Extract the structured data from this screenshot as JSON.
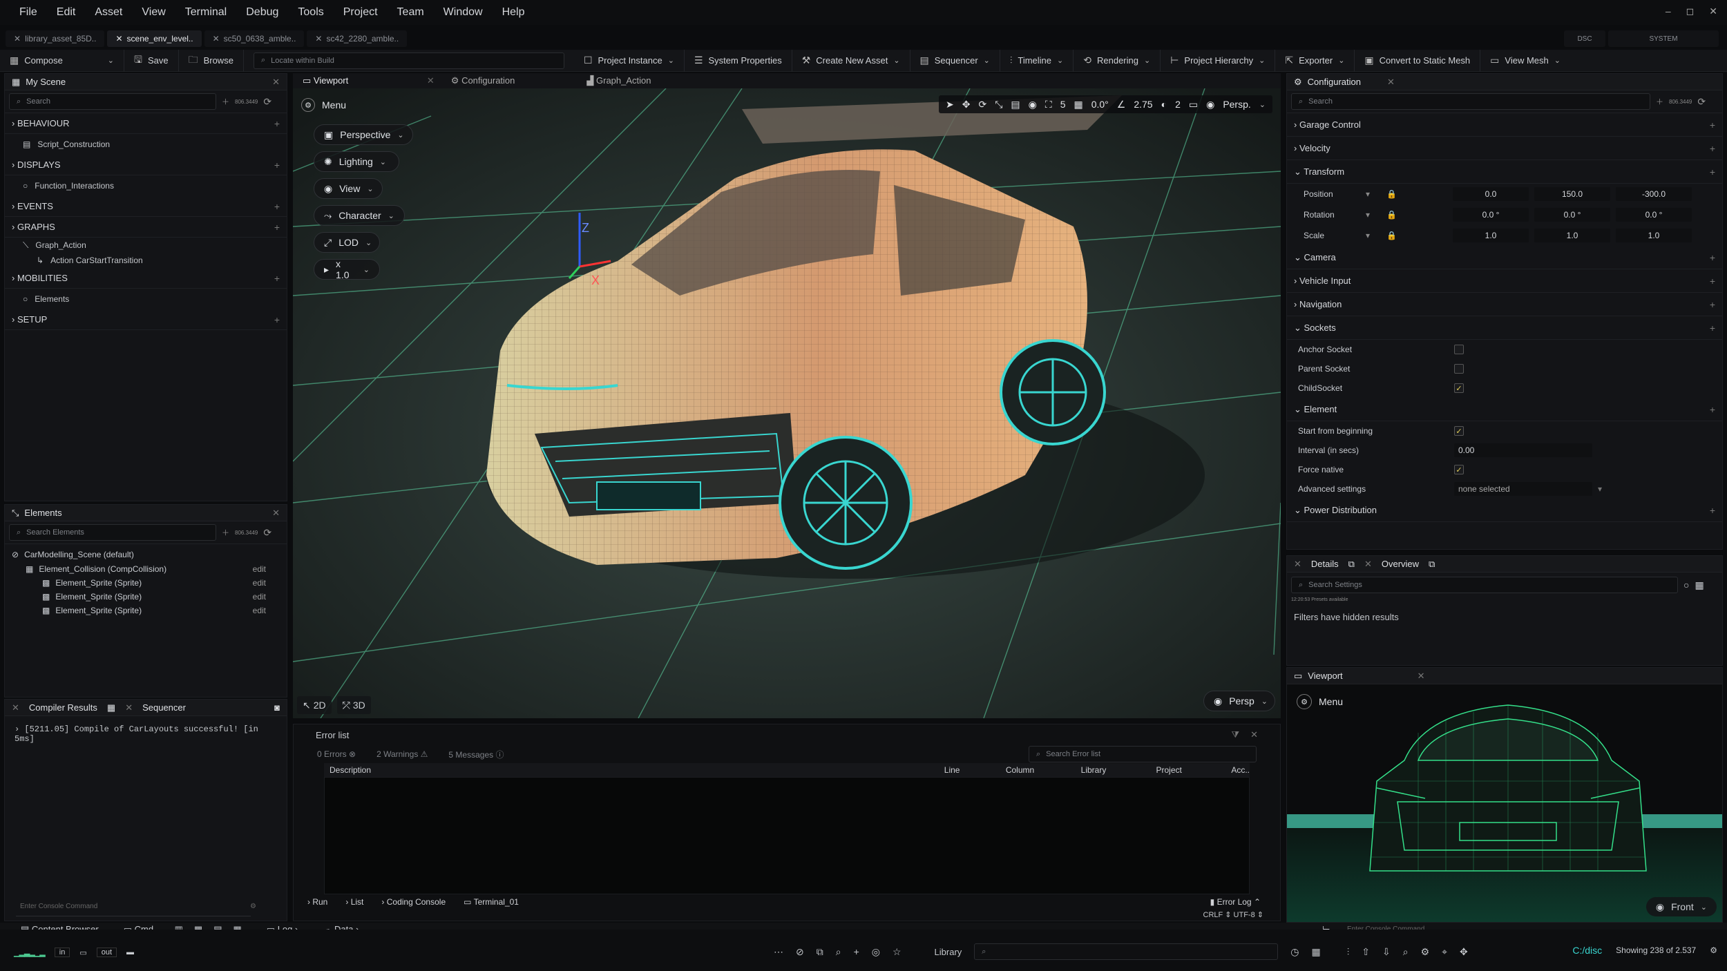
{
  "menu": [
    "File",
    "Edit",
    "Asset",
    "View",
    "Terminal",
    "Debug",
    "Tools",
    "Project",
    "Team",
    "Window",
    "Help"
  ],
  "window_controls": [
    "–",
    "◻",
    "✕"
  ],
  "doc_tabs": [
    {
      "label": "library_asset_85D.."
    },
    {
      "label": "scene_env_level.."
    },
    {
      "label": "sc50_0638_amble.."
    },
    {
      "label": "sc42_2280_amble.."
    }
  ],
  "top_right_tabs": [
    "DSC",
    "SYSTEM"
  ],
  "toolbar": {
    "compose": "Compose",
    "save": "Save",
    "browse": "Browse",
    "locate_placeholder": "Locate within Build",
    "project_instance": "Project Instance",
    "system_properties": "System Properties",
    "create_new_asset": "Create New Asset",
    "sequencer": "Sequencer",
    "timeline": "Timeline",
    "rendering": "Rendering",
    "project_hierarchy": "Project Hierarchy",
    "exporter": "Exporter",
    "convert": "Convert to Static Mesh",
    "view_mesh": "View Mesh"
  },
  "scene_panel": {
    "title": "My Scene",
    "search": "Search",
    "count": "806.3449",
    "sections": [
      {
        "name": "BEHAVIOUR",
        "items": [
          "Script_Construction"
        ]
      },
      {
        "name": "DISPLAYS",
        "items": [
          "Function_Interactions"
        ]
      },
      {
        "name": "EVENTS",
        "items": []
      },
      {
        "name": "GRAPHS",
        "items": [
          "Graph_Action",
          "Action CarStartTransition"
        ]
      },
      {
        "name": "MOBILITIES",
        "items": [
          "Elements"
        ]
      },
      {
        "name": "SETUP",
        "items": []
      }
    ]
  },
  "elements_panel": {
    "title": "Elements",
    "search": "Search Elements",
    "count": "806.3449",
    "root": "CarModelling_Scene (default)",
    "collision": "Element_Collision (CompCollision)",
    "sprites": [
      "Element_Sprite (Sprite)",
      "Element_Sprite (Sprite)",
      "Element_Sprite (Sprite)"
    ],
    "edit": "edit"
  },
  "compiler": {
    "tab1": "Compiler Results",
    "tab2": "Sequencer",
    "line": "[5211.05] Compile of CarLayouts successful! [in 5ms]",
    "console_placeholder": "Enter Console Command"
  },
  "viewport": {
    "tabs": [
      "Viewport",
      "Configuration",
      "Graph_Action"
    ],
    "menu": "Menu",
    "buttons": [
      "Perspective",
      "Lighting",
      "View",
      "Character",
      "LOD",
      "x 1.0"
    ],
    "top_values": {
      "grid": "5",
      "angle": "0.0°",
      "scale": "2.75",
      "cams": "2",
      "persp": "Persp."
    },
    "mode2d": "2D",
    "mode3d": "3D",
    "persp_bottom": "Persp",
    "axis_z": "Z",
    "axis_x": "X"
  },
  "config_panel": {
    "title": "Configuration",
    "search": "Search",
    "count": "806.3449",
    "sections": [
      "Garage Control",
      "Velocity",
      "Transform",
      "Camera",
      "Vehicle Input",
      "Navigation",
      "Sockets",
      "Element",
      "Power Distribution"
    ],
    "transform": [
      {
        "label": "Position",
        "v": [
          "0.0",
          "150.0",
          "-300.0"
        ]
      },
      {
        "label": "Rotation",
        "v": [
          "0.0 °",
          "0.0 °",
          "0.0 °"
        ]
      },
      {
        "label": "Scale",
        "v": [
          "1.0",
          "1.0",
          "1.0"
        ]
      }
    ],
    "sockets": [
      {
        "label": "Anchor Socket",
        "checked": false
      },
      {
        "label": "Parent Socket",
        "checked": false
      },
      {
        "label": "ChildSocket",
        "checked": true
      }
    ],
    "element": {
      "start": "Start from beginning",
      "interval": "Interval (in secs)",
      "interval_val": "0.00",
      "force": "Force native",
      "advanced": "Advanced settings",
      "advanced_val": "none selected"
    }
  },
  "details_panel": {
    "tab1": "Details",
    "tab2": "Overview",
    "search": "Search Settings",
    "note": "12:20:53 Presets available",
    "filters": "Filters have hidden results"
  },
  "mini_viewport": {
    "title": "Viewport",
    "menu": "Menu",
    "view": "Front"
  },
  "error_list": {
    "title": "Error list",
    "errors": "0 Errors",
    "warnings": "2 Warnings",
    "messages": "5 Messages",
    "search": "Search Error list",
    "columns": [
      "Description",
      "Line",
      "Column",
      "Library",
      "Project",
      "Acc.."
    ],
    "bottom_tabs": [
      "Run",
      "List",
      "Coding Console",
      "Terminal_01"
    ],
    "error_log": "Error Log",
    "encoding": "CRLF ⇕  UTF-8 ⇕"
  },
  "bottom_bar": {
    "content_browser": "Content Browser",
    "cmd": "Cmd",
    "log": "Log",
    "data": "Data",
    "in": "in",
    "out": "out",
    "library": "Library",
    "path": "C:/disc",
    "showing": "Showing 238 of 2.537",
    "console_placeholder": "Enter Console Command"
  },
  "colors": {
    "accent_yellow": "#e6d25a",
    "wire_orange": "#e8a25a",
    "wire_cyan": "#39d6d0",
    "wire_green": "#34e08a",
    "bg": "#0b0c0e"
  }
}
